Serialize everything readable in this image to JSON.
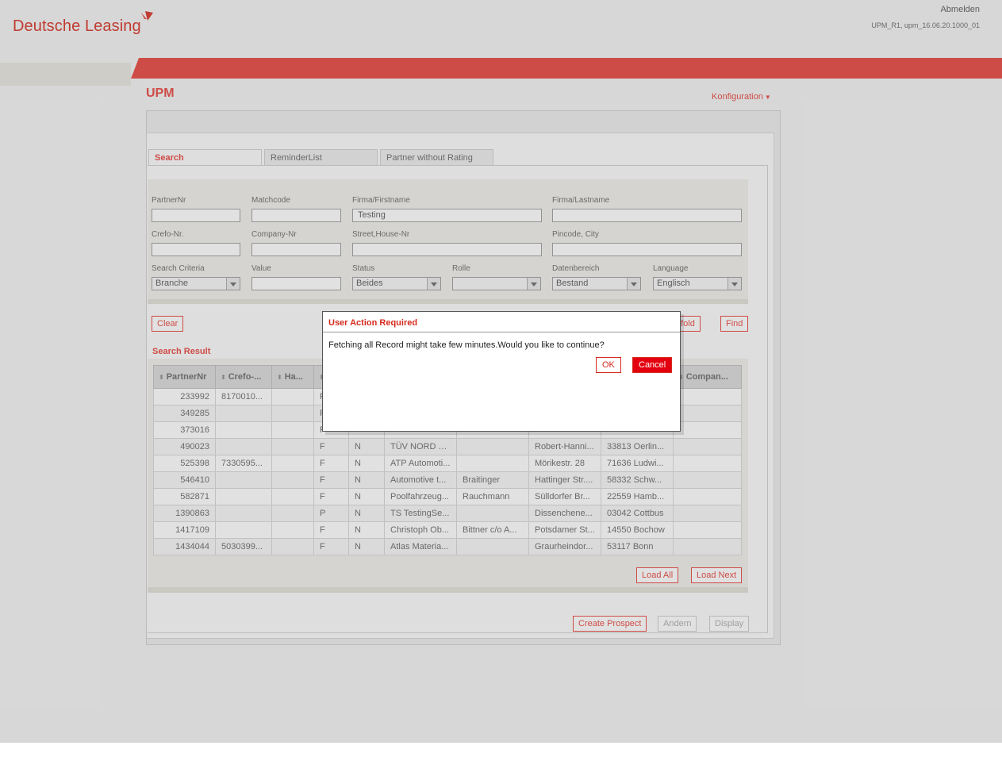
{
  "header": {
    "logo_text": "Deutsche Leasing",
    "logout_label": "Abmelden",
    "version": "UPM_R1, upm_16.06.20.1000_01"
  },
  "page": {
    "title": "UPM",
    "config_label": "Konfiguration"
  },
  "tabs": [
    {
      "label": "Search",
      "active": true
    },
    {
      "label": "ReminderList",
      "active": false
    },
    {
      "label": "Partner without Rating",
      "active": false
    }
  ],
  "form": {
    "partner_nr": {
      "label": "PartnerNr",
      "value": ""
    },
    "matchcode": {
      "label": "Matchcode",
      "value": ""
    },
    "firma_firstname": {
      "label": "Firma/Firstname",
      "value": "Testing"
    },
    "firma_lastname": {
      "label": "Firma/Lastname",
      "value": ""
    },
    "crefo_nr": {
      "label": "Crefo-Nr.",
      "value": ""
    },
    "company_nr": {
      "label": "Company-Nr",
      "value": ""
    },
    "street": {
      "label": "Street,House-Nr",
      "value": ""
    },
    "pincode_city": {
      "label": "Pincode, City",
      "value": ""
    },
    "search_criteria": {
      "label": "Search Criteria",
      "value": "Branche"
    },
    "value": {
      "label": "Value",
      "value": ""
    },
    "status": {
      "label": "Status",
      "value": "Beides"
    },
    "rolle": {
      "label": "Rolle",
      "value": ""
    },
    "datenbereich": {
      "label": "Datenbereich",
      "value": "Bestand"
    },
    "language": {
      "label": "Language",
      "value": "Englisch"
    }
  },
  "actions": {
    "clear": "Clear",
    "crefo": "efold",
    "find": "Find"
  },
  "results": {
    "title": "Search Result",
    "columns": [
      "PartnerNr",
      "Crefo-...",
      "Ha...",
      "",
      "",
      "",
      "",
      "",
      "",
      "Compan..."
    ],
    "rows": [
      [
        "233992",
        "8170010...",
        "",
        "F",
        "",
        "",
        "",
        "",
        "",
        ""
      ],
      [
        "349285",
        "",
        "",
        "F",
        "",
        "",
        "",
        "",
        "",
        ""
      ],
      [
        "373016",
        "",
        "",
        "F",
        "",
        "",
        "",
        "",
        "",
        ""
      ],
      [
        "490023",
        "",
        "",
        "F",
        "N",
        "TÜV NORD M...",
        "",
        "Robert-Hanni...",
        "33813 Oerlin...",
        ""
      ],
      [
        "525398",
        "7330595...",
        "",
        "F",
        "N",
        "ATP Automoti...",
        "",
        "Mörikestr. 28",
        "71636 Ludwi...",
        ""
      ],
      [
        "546410",
        "",
        "",
        "F",
        "N",
        "Automotive t...",
        "Braitinger",
        "Hattinger Str....",
        "58332 Schw...",
        ""
      ],
      [
        "582871",
        "",
        "",
        "F",
        "N",
        "Poolfahrzeug...",
        "Rauchmann",
        "Sülldorfer Br...",
        "22559 Hamb...",
        ""
      ],
      [
        "1390863",
        "",
        "",
        "P",
        "N",
        "TS TestingSe...",
        "",
        "Dissenchene...",
        "03042 Cottbus",
        ""
      ],
      [
        "1417109",
        "",
        "",
        "F",
        "N",
        "Christoph Ob...",
        "Bittner c/o A...",
        "Potsdamer St...",
        "14550 Bochow",
        ""
      ],
      [
        "1434044",
        "5030399...",
        "",
        "F",
        "N",
        "Atlas Materia...",
        "",
        "Graurheindor...",
        "53117 Bonn",
        ""
      ]
    ],
    "load_all": "Load All",
    "load_next": "Load Next"
  },
  "footer_actions": {
    "create_prospect": "Create Prospect",
    "andern": "Andern",
    "display": "Display"
  },
  "dialog": {
    "title": "User Action Required",
    "message": "Fetching all Record might take few minutes.Would you like to continue?",
    "ok": "OK",
    "cancel": "Cancel"
  },
  "colors": {
    "brand_red": "#e7413a",
    "dialog_cancel_bg": "#e3000f"
  }
}
